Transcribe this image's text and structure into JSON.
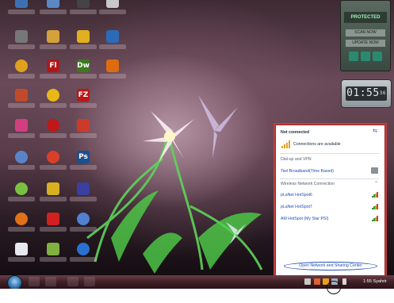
{
  "gadgets": {
    "antivirus": {
      "status": "PROTECTED",
      "scan_label": "SCAN NOW",
      "update_label": "UPDATE NOW"
    },
    "clock": {
      "time": "01:55",
      "seconds": "36"
    }
  },
  "network_flyout": {
    "status_title": "Not connected",
    "availability": "Connections are available",
    "dialup_header": "Dial-up and VPN",
    "dialup_item": "Tsel Broadband(Time Based)",
    "wireless_header": "Wireless Network Connection",
    "networks": [
      "pLaNet HotSpot6",
      "pLaNet HotSpot7",
      "AM HotSpot (My Star PSI)"
    ],
    "open_center": "Open Network and Sharing Center"
  },
  "taskbar": {
    "clock_text": "1:55 Syahrir"
  },
  "colors": {
    "flyout_border": "#a12020",
    "link_blue": "#1f4fb0",
    "taskbar": "#3e1f26"
  }
}
